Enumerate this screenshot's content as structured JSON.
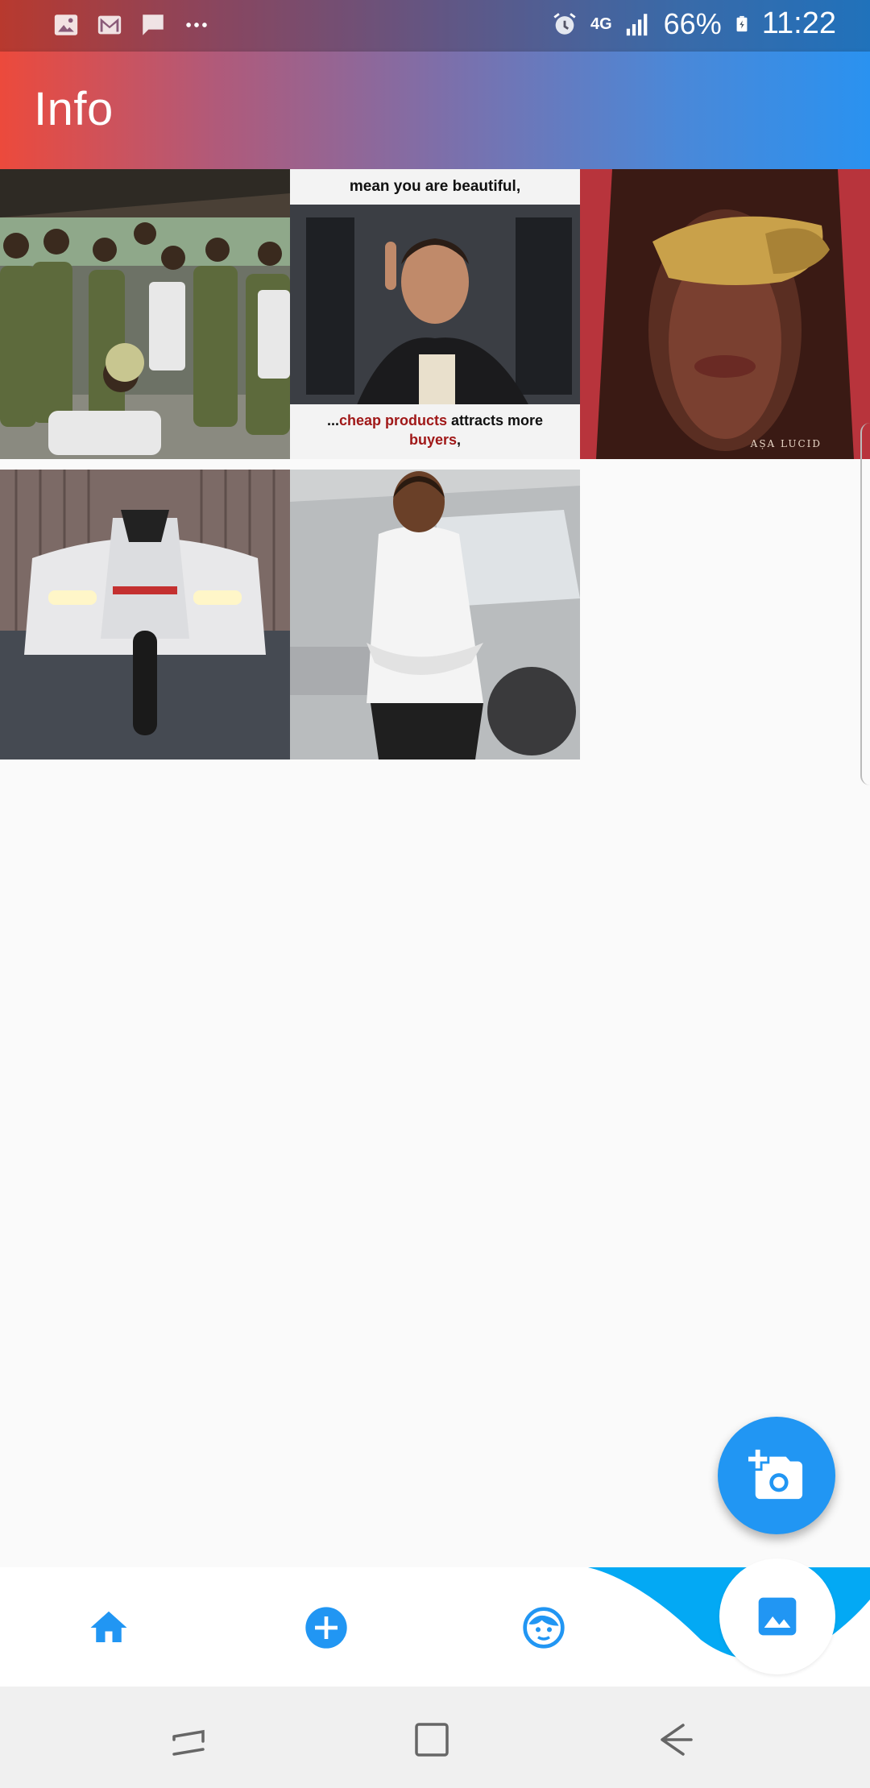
{
  "status_bar": {
    "battery": "66%",
    "time": "11:22",
    "network": "4G",
    "left_icons": [
      "image-icon",
      "gmail-icon",
      "message-icon",
      "more-dots-icon"
    ],
    "right_icons": [
      "alarm-icon",
      "network-4g-icon",
      "signal-icon",
      "battery-icon"
    ]
  },
  "app_bar": {
    "title": "Info"
  },
  "gallery": {
    "tiles": [
      {
        "name": "group-photo-tile"
      },
      {
        "name": "meme-tile",
        "top_text": "mean you are beautiful,",
        "bottom_text_pre": "...",
        "bottom_text_red1": "cheap products",
        "bottom_text_mid": " attracts more",
        "bottom_text_red2": "buyers",
        "bottom_text_post": ","
      },
      {
        "name": "portrait-tile",
        "watermark": "AṢA LUCID"
      },
      {
        "name": "motorcycle-tile"
      },
      {
        "name": "woman-car-tile"
      }
    ]
  },
  "fab": {
    "icon": "add-camera-icon",
    "color": "#2196f3"
  },
  "bottom_nav": {
    "items": [
      "home-icon",
      "add-circle-icon",
      "face-icon",
      "image-icon"
    ],
    "accent": "#2196f3",
    "curve_color": "#03a9f4"
  },
  "system_nav": {
    "buttons": [
      "recents-icon",
      "home-square-icon",
      "back-icon"
    ]
  }
}
